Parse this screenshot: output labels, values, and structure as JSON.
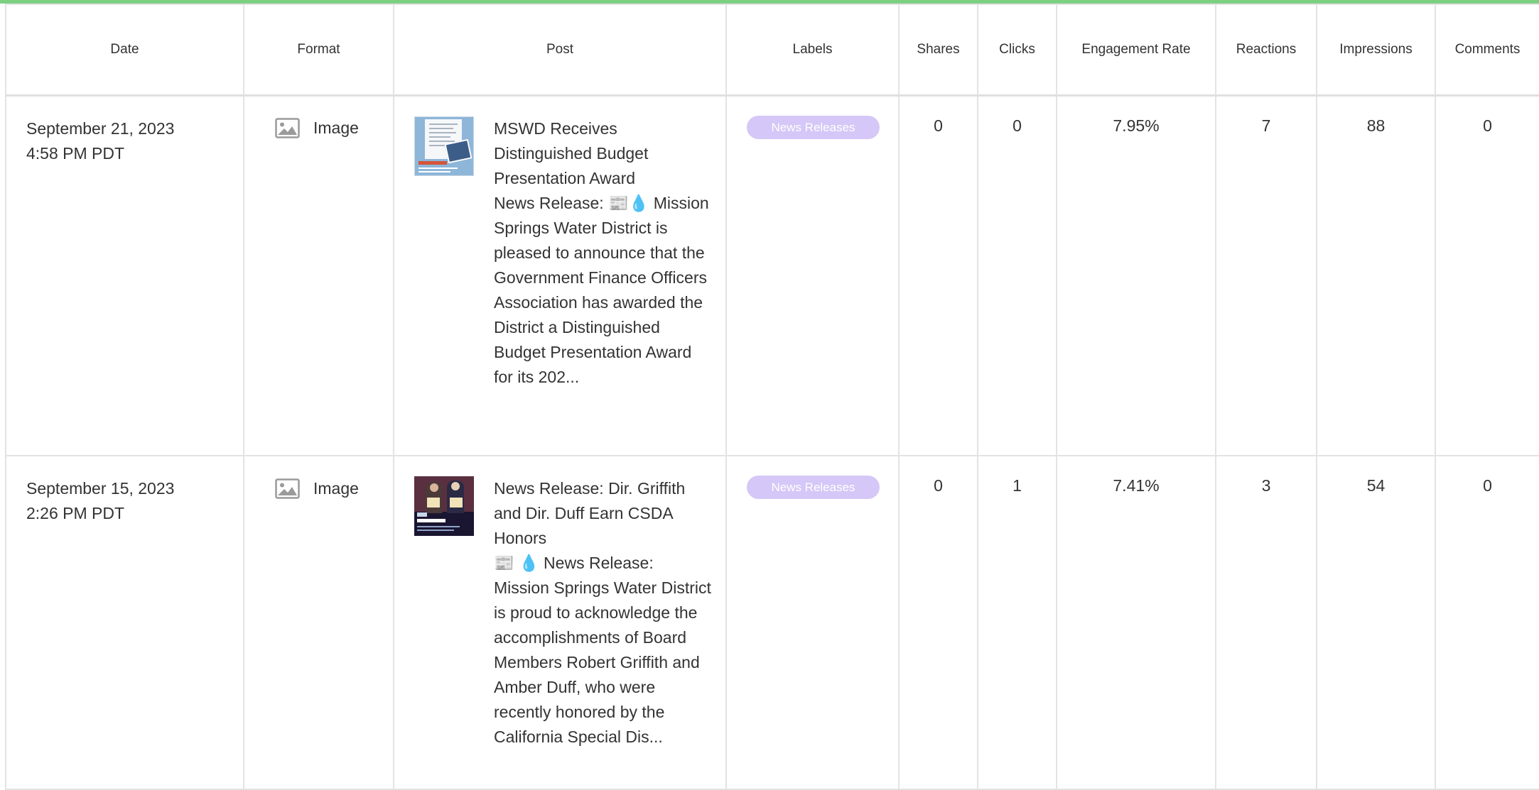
{
  "table": {
    "columns": [
      "Date",
      "Format",
      "Post",
      "Labels",
      "Shares",
      "Clicks",
      "Engagement Rate",
      "Reactions",
      "Impressions",
      "Comments"
    ],
    "rows": [
      {
        "date": "September 21, 2023",
        "time": "4:58 PM PDT",
        "format": "Image",
        "format_icon": "image-icon",
        "post_title": "MSWD Receives Distinguished Budget Presentation Award",
        "post_body": "News Release: 📰💧 Mission Springs Water District is pleased to announce that the Government Finance Officers Association has awarded the District a Distinguished Budget Presentation Award for its 202...",
        "label": "News Releases",
        "shares": "0",
        "clicks": "0",
        "engagement_rate": "7.95%",
        "reactions": "7",
        "impressions": "88",
        "comments": "0"
      },
      {
        "date": "September 15, 2023",
        "time": "2:26 PM PDT",
        "format": "Image",
        "format_icon": "image-icon",
        "post_title": "News Release: Dir. Griffith and Dir. Duff Earn CSDA Honors",
        "post_body": "📰 💧 News Release: Mission Springs Water District is proud to acknowledge the accomplishments of Board Members Robert Griffith and Amber Duff, who were recently honored by the California Special Dis...",
        "label": "News Releases",
        "shares": "0",
        "clicks": "1",
        "engagement_rate": "7.41%",
        "reactions": "3",
        "impressions": "54",
        "comments": "0"
      }
    ]
  },
  "colors": {
    "accent_bar": "#7dcf82",
    "label_pill": "#d5c7f7",
    "grid": "#e3e3e3"
  }
}
